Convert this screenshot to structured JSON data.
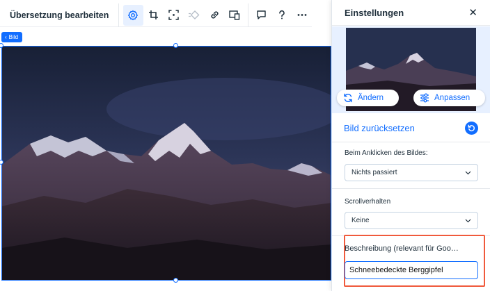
{
  "toolbar": {
    "edit_translation_label": "Übersetzung bearbeiten",
    "icons": [
      "settings-icon",
      "crop-icon",
      "focal-point-icon",
      "animation-icon",
      "link-icon",
      "responsive-icon",
      "comment-icon",
      "help-icon",
      "more-icon"
    ]
  },
  "canvas": {
    "element_tag": "Bild"
  },
  "panel": {
    "title": "Einstellungen",
    "change_label": "Ändern",
    "adjust_label": "Anpassen",
    "reset_label": "Bild zurücksetzen",
    "click_action_label": "Beim Anklicken des Bildes:",
    "click_action_value": "Nichts passiert",
    "scroll_label": "Scrollverhalten",
    "scroll_value": "Keine",
    "description_label": "Beschreibung (relevant für Goo…",
    "description_value": "Schneebedeckte Berggipfel"
  },
  "colors": {
    "accent": "#116dff",
    "highlight": "#f05a3c",
    "sky_top": "#1b2238",
    "sky_bottom": "#3e4873"
  }
}
